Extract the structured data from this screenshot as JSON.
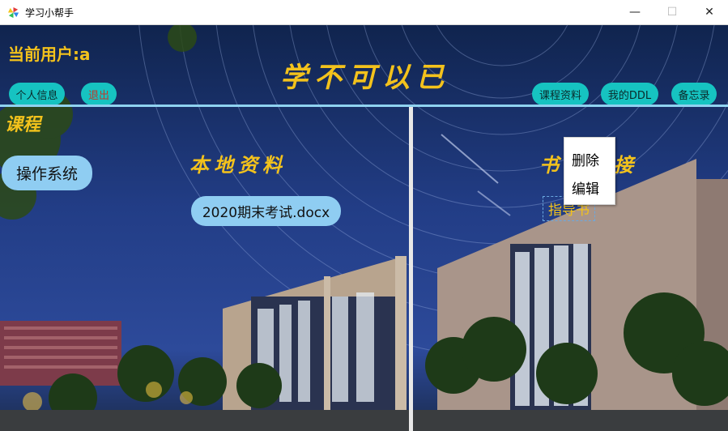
{
  "window": {
    "title": "学习小帮手",
    "minimize_glyph": "—",
    "maximize_glyph": "☐",
    "close_glyph": "✕"
  },
  "header": {
    "current_user": "当前用户:a",
    "slogan": "学不可以已"
  },
  "left_buttons": {
    "profile": "个人信息",
    "logout": "退出"
  },
  "right_buttons": {
    "materials": "课程资料",
    "ddl": "我的DDL",
    "memo": "备忘录"
  },
  "sections": {
    "course": "课程",
    "local": "本地资料",
    "book_left": "书",
    "book_right": "接"
  },
  "course_list": [
    "操作系统"
  ],
  "local_files": [
    "2020期末考试.docx"
  ],
  "links": [
    "指导书"
  ],
  "context_menu": {
    "delete": "删除",
    "edit": "编辑"
  },
  "colors": {
    "accent_yellow": "#f3c21c",
    "button_teal": "#16c3c1",
    "chip_blue": "#8fcdf2",
    "logout_red": "#c0392b"
  },
  "icons": {
    "app": "pinwheel-app-icon"
  }
}
